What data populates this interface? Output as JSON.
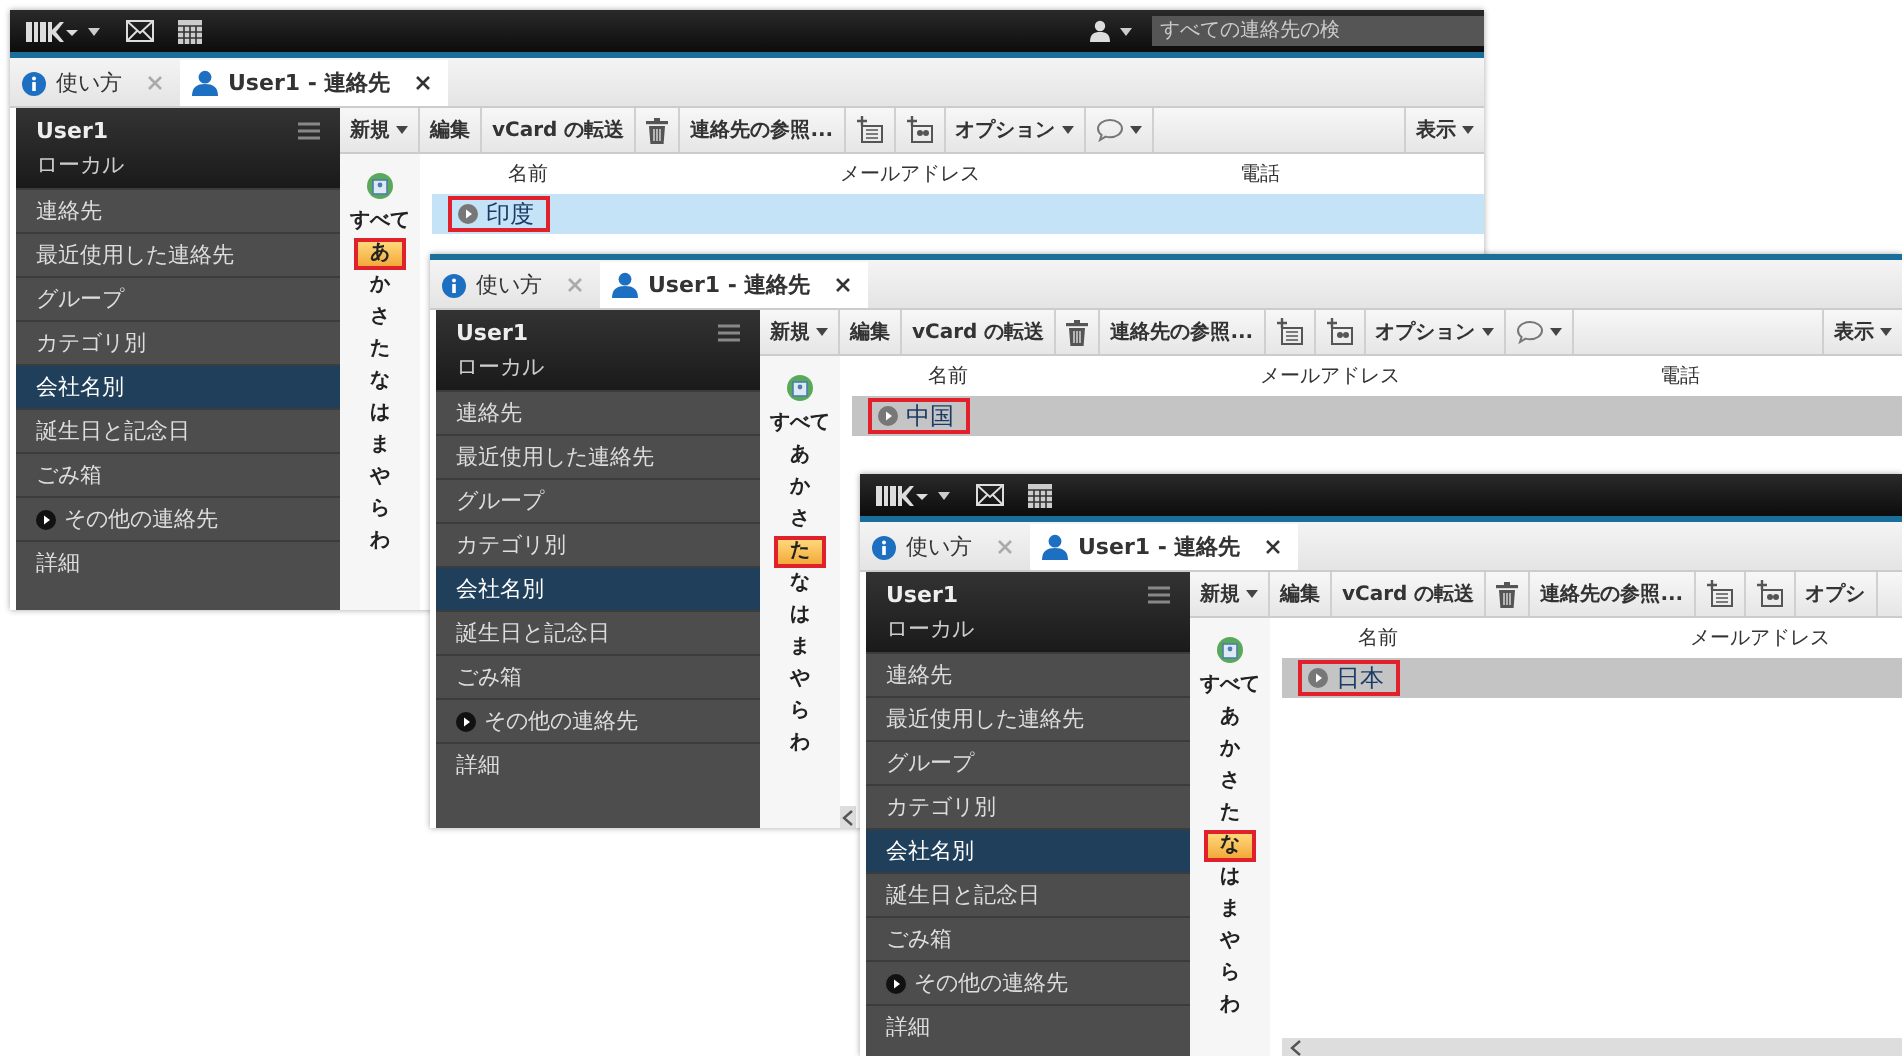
{
  "windows": [
    {
      "kind": "full",
      "focused": true,
      "top_bar": {
        "search": {
          "placeholder": "すべての連絡先の検"
        }
      },
      "tabs": [
        {
          "label": "使い方",
          "selected": false
        },
        {
          "label": "User1 - 連絡先",
          "selected": true
        }
      ],
      "sidebar": {
        "account": "User1",
        "location": "ローカル",
        "items": [
          {
            "label": "連絡先",
            "selected": false,
            "expandable": false
          },
          {
            "label": "最近使用した連絡先",
            "selected": false,
            "expandable": false
          },
          {
            "label": "グループ",
            "selected": false,
            "expandable": false
          },
          {
            "label": "カテゴリ別",
            "selected": false,
            "expandable": false
          },
          {
            "label": "会社名別",
            "selected": true,
            "expandable": false
          },
          {
            "label": "誕生日と記念日",
            "selected": false,
            "expandable": false
          },
          {
            "label": "ごみ箱",
            "selected": false,
            "expandable": false
          },
          {
            "label": "その他の連絡先",
            "selected": false,
            "expandable": true
          },
          {
            "label": "詳細",
            "selected": false,
            "expandable": false
          }
        ]
      },
      "toolbar": [
        {
          "kind": "text",
          "label": "新規",
          "dropdown": true
        },
        {
          "kind": "text",
          "label": "編集",
          "dropdown": false
        },
        {
          "kind": "text",
          "label": "vCard の転送",
          "dropdown": false
        },
        {
          "kind": "trash",
          "dropdown": false
        },
        {
          "kind": "text",
          "label": "連絡先の参照...",
          "dropdown": false
        },
        {
          "kind": "add-contact",
          "dropdown": false
        },
        {
          "kind": "add-group",
          "dropdown": false
        },
        {
          "kind": "text",
          "label": "オプション",
          "dropdown": true
        },
        {
          "kind": "chat",
          "dropdown": true
        },
        {
          "kind": "view",
          "label": "表示",
          "dropdown": true
        }
      ],
      "index": [
        {
          "label": "すべて",
          "selected": false
        },
        {
          "label": "あ",
          "selected": true
        },
        {
          "label": "か",
          "selected": false
        },
        {
          "label": "さ",
          "selected": false
        },
        {
          "label": "た",
          "selected": false
        },
        {
          "label": "な",
          "selected": false
        },
        {
          "label": "は",
          "selected": false
        },
        {
          "label": "ま",
          "selected": false
        },
        {
          "label": "や",
          "selected": false
        },
        {
          "label": "ら",
          "selected": false
        },
        {
          "label": "わ",
          "selected": false
        }
      ],
      "columns": [
        "名前",
        "メールアドレス",
        "電話"
      ],
      "rows": [
        {
          "name": "印度",
          "selected": true,
          "marked": true
        }
      ]
    },
    {
      "kind": "tabs-only",
      "focused": false,
      "tabs": [
        {
          "label": "使い方",
          "selected": false
        },
        {
          "label": "User1 - 連絡先",
          "selected": true
        }
      ],
      "sidebar": {
        "account": "User1",
        "location": "ローカル",
        "items": [
          {
            "label": "連絡先",
            "selected": false,
            "expandable": false
          },
          {
            "label": "最近使用した連絡先",
            "selected": false,
            "expandable": false
          },
          {
            "label": "グループ",
            "selected": false,
            "expandable": false
          },
          {
            "label": "カテゴリ別",
            "selected": false,
            "expandable": false
          },
          {
            "label": "会社名別",
            "selected": true,
            "expandable": false
          },
          {
            "label": "誕生日と記念日",
            "selected": false,
            "expandable": false
          },
          {
            "label": "ごみ箱",
            "selected": false,
            "expandable": false
          },
          {
            "label": "その他の連絡先",
            "selected": false,
            "expandable": true
          },
          {
            "label": "詳細",
            "selected": false,
            "expandable": false
          }
        ]
      },
      "toolbar": [
        {
          "kind": "text",
          "label": "新規",
          "dropdown": true
        },
        {
          "kind": "text",
          "label": "編集",
          "dropdown": false
        },
        {
          "kind": "text",
          "label": "vCard の転送",
          "dropdown": false
        },
        {
          "kind": "trash",
          "dropdown": false
        },
        {
          "kind": "text",
          "label": "連絡先の参照...",
          "dropdown": false
        },
        {
          "kind": "add-contact",
          "dropdown": false
        },
        {
          "kind": "add-group",
          "dropdown": false
        },
        {
          "kind": "text",
          "label": "オプション",
          "dropdown": true
        },
        {
          "kind": "chat",
          "dropdown": true
        },
        {
          "kind": "view",
          "label": "表示",
          "dropdown": true
        }
      ],
      "index": [
        {
          "label": "すべて",
          "selected": false
        },
        {
          "label": "あ",
          "selected": false
        },
        {
          "label": "か",
          "selected": false
        },
        {
          "label": "さ",
          "selected": false
        },
        {
          "label": "た",
          "selected": true
        },
        {
          "label": "な",
          "selected": false
        },
        {
          "label": "は",
          "selected": false
        },
        {
          "label": "ま",
          "selected": false
        },
        {
          "label": "や",
          "selected": false
        },
        {
          "label": "ら",
          "selected": false
        },
        {
          "label": "わ",
          "selected": false
        }
      ],
      "columns": [
        "名前",
        "メールアドレス",
        "電話"
      ],
      "rows": [
        {
          "name": "中国",
          "selected": true,
          "marked": true
        }
      ]
    },
    {
      "kind": "full",
      "focused": false,
      "tabs": [
        {
          "label": "使い方",
          "selected": false
        },
        {
          "label": "User1 - 連絡先",
          "selected": true
        }
      ],
      "sidebar": {
        "account": "User1",
        "location": "ローカル",
        "items": [
          {
            "label": "連絡先",
            "selected": false,
            "expandable": false
          },
          {
            "label": "最近使用した連絡先",
            "selected": false,
            "expandable": false
          },
          {
            "label": "グループ",
            "selected": false,
            "expandable": false
          },
          {
            "label": "カテゴリ別",
            "selected": false,
            "expandable": false
          },
          {
            "label": "会社名別",
            "selected": true,
            "expandable": false
          },
          {
            "label": "誕生日と記念日",
            "selected": false,
            "expandable": false
          },
          {
            "label": "ごみ箱",
            "selected": false,
            "expandable": false
          },
          {
            "label": "その他の連絡先",
            "selected": false,
            "expandable": true
          },
          {
            "label": "詳細",
            "selected": false,
            "expandable": false
          }
        ]
      },
      "toolbar": [
        {
          "kind": "text",
          "label": "新規",
          "dropdown": true
        },
        {
          "kind": "text",
          "label": "編集",
          "dropdown": false
        },
        {
          "kind": "text",
          "label": "vCard の転送",
          "dropdown": false
        },
        {
          "kind": "trash",
          "dropdown": false
        },
        {
          "kind": "text",
          "label": "連絡先の参照...",
          "dropdown": false
        },
        {
          "kind": "add-contact",
          "dropdown": false
        },
        {
          "kind": "add-group",
          "dropdown": false
        },
        {
          "kind": "text",
          "label": "オプシ",
          "dropdown": false
        }
      ],
      "index": [
        {
          "label": "すべて",
          "selected": false
        },
        {
          "label": "あ",
          "selected": false
        },
        {
          "label": "か",
          "selected": false
        },
        {
          "label": "さ",
          "selected": false
        },
        {
          "label": "た",
          "selected": false
        },
        {
          "label": "な",
          "selected": true
        },
        {
          "label": "は",
          "selected": false
        },
        {
          "label": "ま",
          "selected": false
        },
        {
          "label": "や",
          "selected": false
        },
        {
          "label": "ら",
          "selected": false
        },
        {
          "label": "わ",
          "selected": false
        }
      ],
      "columns": [
        "名前",
        "メールアドレス"
      ],
      "rows": [
        {
          "name": "日本",
          "selected": true,
          "marked": true
        }
      ]
    }
  ]
}
